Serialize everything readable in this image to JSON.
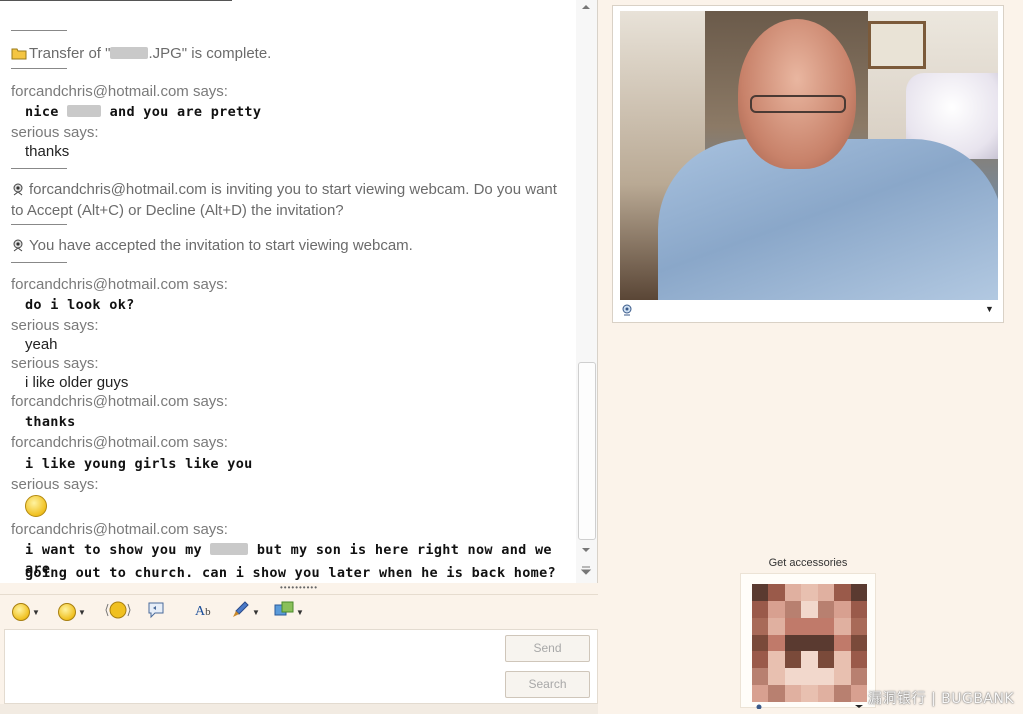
{
  "transcript": {
    "file_transfer": {
      "prefix": "Transfer of \"",
      "filename_suffix": ".JPG\" is complete."
    },
    "line1_sender": "forcandchris@hotmail.com says:",
    "line1_pre": "nice",
    "line1_post": "and you are pretty",
    "line2_sender": "serious says:",
    "line2_text": "thanks",
    "invite_text": "forcandchris@hotmail.com is inviting you to start viewing webcam. Do you want to Accept (Alt+C) or Decline (Alt+D) the invitation?",
    "accepted_text": "You have accepted the invitation to start viewing webcam.",
    "m3_sender": "forcandchris@hotmail.com says:",
    "m3_text": "do i look ok?",
    "m4_sender": "serious says:",
    "m4_text": "yeah",
    "m5_sender": "serious says:",
    "m5_text": "i like older guys",
    "m6_sender": "forcandchris@hotmail.com says:",
    "m6_text": "thanks",
    "m7_sender": "forcandchris@hotmail.com says:",
    "m7_text": "i like young girls like you",
    "m8_sender": "serious says:",
    "m9_sender": "forcandchris@hotmail.com says:",
    "m9_pre": "i want to show you my",
    "m9_post": "but my son is here right now and we are",
    "m9_line2": "going out to church. can i show you later when he is back home?"
  },
  "input": {
    "send_label": "Send",
    "search_label": "Search"
  },
  "toolbar": {
    "items": [
      "emoticon-icon",
      "wink-icon",
      "nudge-icon",
      "voice-clip-icon",
      "font-icon",
      "background-icon",
      "games-icon"
    ]
  },
  "webcam": {
    "menu_glyph": "▼"
  },
  "accessories": {
    "label": "Get accessories"
  },
  "watermark": "漏洞银行 | BUGBANK",
  "colors": {
    "window_bg": "#fbf3ea",
    "chat_bg": "#ffffff",
    "sender_text": "#7a7a7a",
    "message_text": "#111111"
  }
}
